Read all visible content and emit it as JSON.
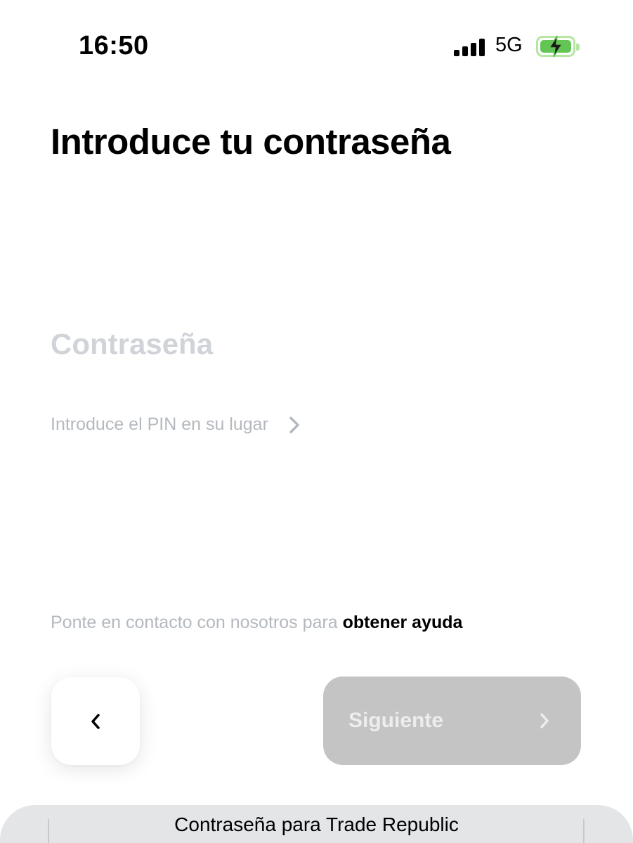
{
  "status_bar": {
    "time": "16:50",
    "network": "5G",
    "battery_charging": true,
    "signal_bars": 4
  },
  "page": {
    "title": "Introduce tu contraseña"
  },
  "password_field": {
    "placeholder": "Contraseña",
    "value": ""
  },
  "pin_link": {
    "label": "Introduce el PIN en su lugar",
    "icon": "chevron-right-icon"
  },
  "help": {
    "prefix": "Ponte en contacto con nosotros para ",
    "link": "obtener ayuda"
  },
  "navigation": {
    "back_icon": "chevron-left-icon",
    "next_label": "Siguiente",
    "next_icon": "chevron-right-icon",
    "next_enabled": false
  },
  "keyboard_autofill": {
    "suggestion": "Contraseña para Trade Republic"
  },
  "colors": {
    "text_primary": "#000000",
    "text_muted": "#b4b9bf",
    "placeholder": "#d0d4d9",
    "button_disabled_bg": "#c4c4c4",
    "battery_green": "#62c554",
    "autofill_bg": "#e4e5e7"
  }
}
